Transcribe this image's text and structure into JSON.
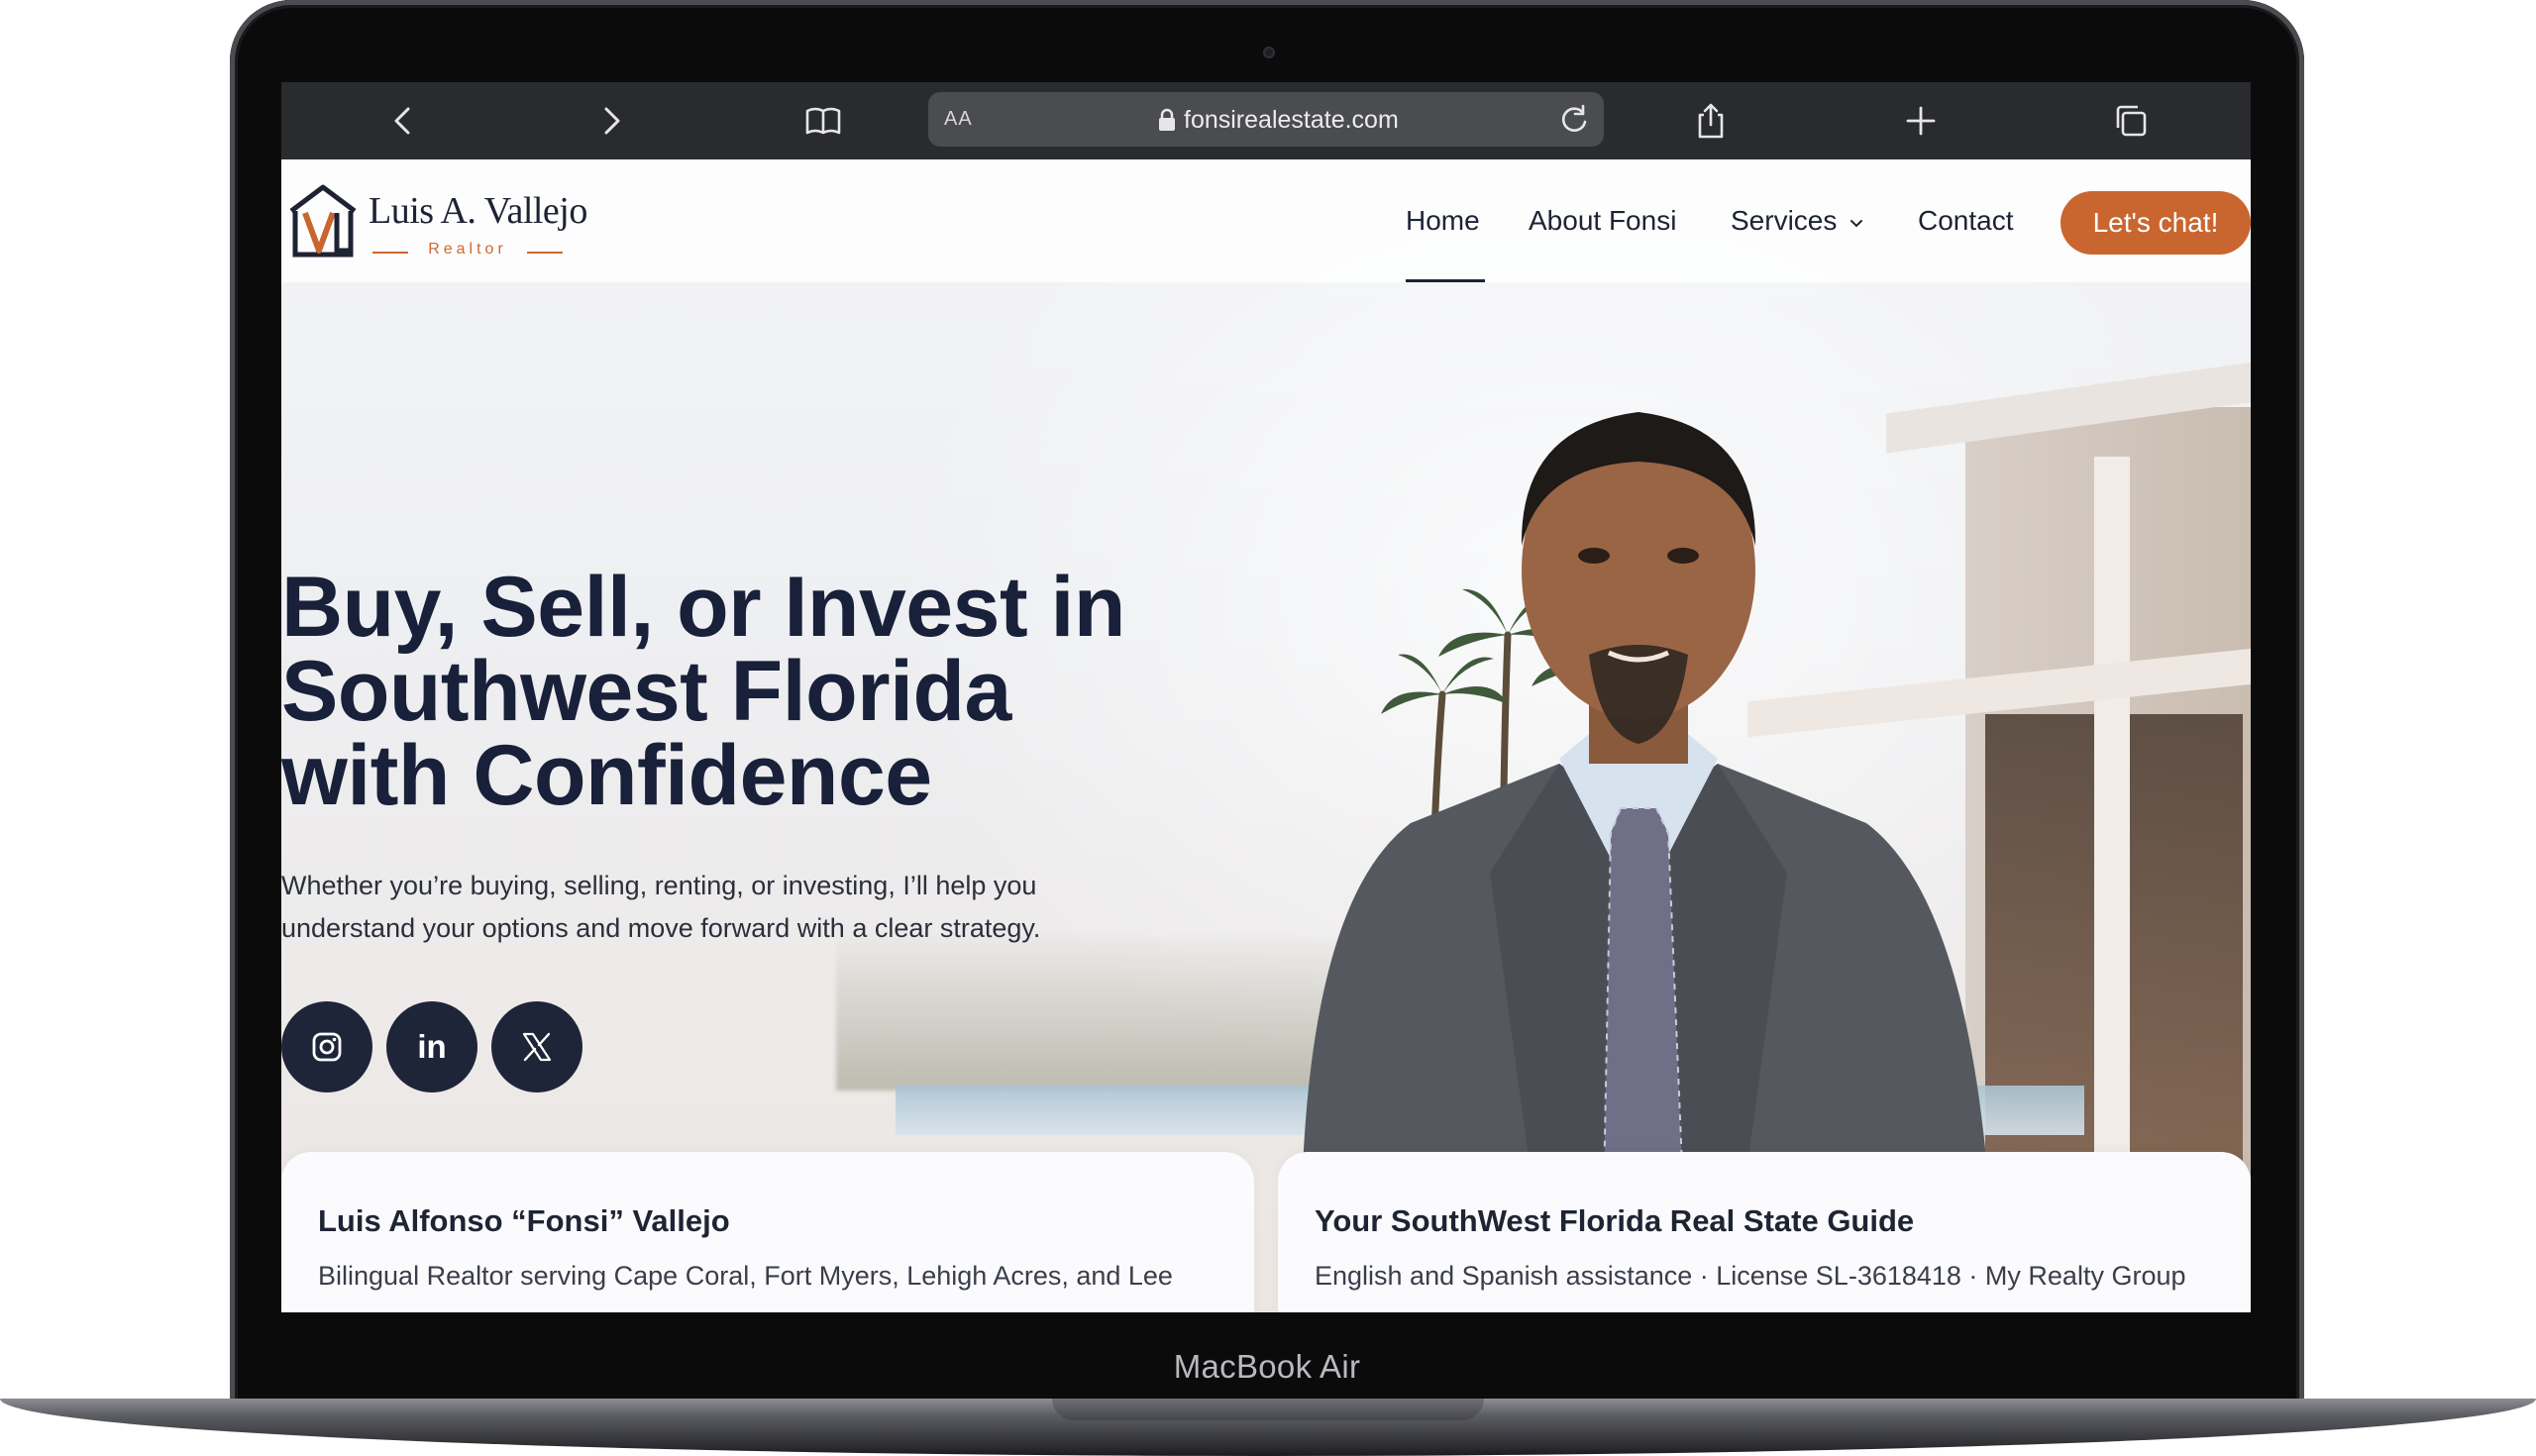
{
  "device": {
    "label": "MacBook Air"
  },
  "browser": {
    "url": "fonsirealestate.com",
    "text_size_label": "AA",
    "icons": [
      "back-icon",
      "forward-icon",
      "bookmarks-icon",
      "lock-icon",
      "reload-icon",
      "share-icon",
      "new-tab-icon",
      "tabs-icon"
    ]
  },
  "site": {
    "logo": {
      "name": "Luis A. Vallejo",
      "subtitle": "Realtor",
      "mark_letters": "LV"
    },
    "nav": {
      "items": [
        {
          "label": "Home",
          "active": true
        },
        {
          "label": "About Fonsi"
        },
        {
          "label": "Services",
          "has_dropdown": true
        },
        {
          "label": "Contact"
        }
      ],
      "cta": "Let's chat!"
    },
    "hero": {
      "title_lines": [
        "Buy, Sell, or Invest in",
        "Southwest Florida",
        "with Confidence"
      ],
      "subtitle_lines": [
        "Whether you’re buying, selling, renting, or investing, I’ll help you",
        "understand your options and move forward with a clear strategy."
      ],
      "socials": [
        "instagram-icon",
        "linkedin-icon",
        "x-icon"
      ],
      "linkedin_glyph": "in"
    },
    "cards": [
      {
        "title": "Luis Alfonso “Fonsi” Vallejo",
        "text": "Bilingual Realtor serving Cape Coral, Fort Myers, Lehigh Acres, and Lee"
      },
      {
        "title": "Your SouthWest Florida Real State Guide",
        "text": "English and Spanish assistance · License SL-3618418 · My Realty Group"
      }
    ]
  },
  "colors": {
    "accent": "#c9662f",
    "navy": "#1d2333",
    "toolbar": "#2a2b2e"
  }
}
